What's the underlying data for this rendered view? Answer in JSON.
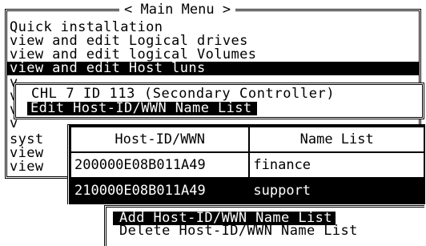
{
  "main_menu": {
    "title": "< Main Menu >",
    "items": [
      "Quick installation",
      "view and edit Logical drives",
      "view and edit logical Volumes",
      "view and edit Host luns",
      "v",
      "v",
      "v",
      "v",
      "syst",
      "view",
      "view"
    ],
    "selected_index": 3
  },
  "channel_box": {
    "title": "CHL 7 ID 113 (Secondary Controller)",
    "option": "Edit Host-ID/WWN Name List"
  },
  "host_table": {
    "headers": [
      "Host-ID/WWN",
      "Name List"
    ],
    "rows": [
      {
        "host": "200000E08B011A49",
        "name": "finance"
      },
      {
        "host": "210000E08B011A49",
        "name": "support"
      }
    ],
    "selected_row": 1
  },
  "action_menu": {
    "items": [
      "Add Host-ID/WWN Name List",
      "Delete Host-ID/WWN Name List"
    ],
    "selected_index": 0
  }
}
